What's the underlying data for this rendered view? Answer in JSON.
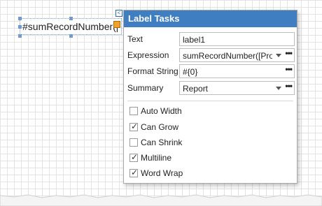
{
  "surface": {
    "label_text": "#sumRecordNumber([F",
    "tasks_glyph": "<"
  },
  "panel": {
    "title": "Label Tasks",
    "fields": {
      "text": {
        "label": "Text",
        "value": "label1"
      },
      "expression": {
        "label": "Expression",
        "value": "sumRecordNumber([Produc"
      },
      "format_string": {
        "label": "Format String",
        "value": "#{0}"
      },
      "summary": {
        "label": "Summary",
        "value": "Report"
      }
    },
    "ellipsis": "•••",
    "checkboxes": [
      {
        "label": "Auto Width",
        "checked": false,
        "mark": ""
      },
      {
        "label": "Can Grow",
        "checked": true,
        "mark": "✓"
      },
      {
        "label": "Can Shrink",
        "checked": false,
        "mark": ""
      },
      {
        "label": "Multiline",
        "checked": true,
        "mark": "✓"
      },
      {
        "label": "Word Wrap",
        "checked": true,
        "mark": "✓"
      }
    ]
  },
  "colors": {
    "header": "#3f7fc1",
    "selection": "#6f9bd1",
    "smart_tag": "#f0a22a"
  }
}
